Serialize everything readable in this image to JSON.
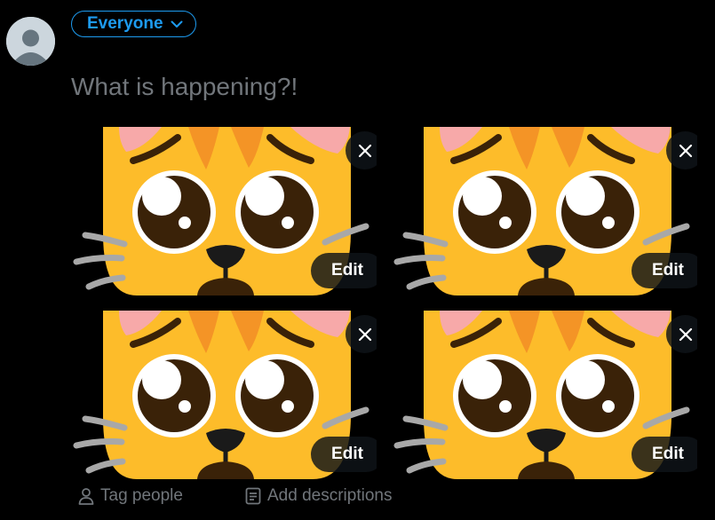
{
  "composer": {
    "audience_label": "Everyone",
    "placeholder": "What is happening?!"
  },
  "media": {
    "items": [
      {
        "edit_label": "Edit"
      },
      {
        "edit_label": "Edit"
      },
      {
        "edit_label": "Edit"
      },
      {
        "edit_label": "Edit"
      }
    ]
  },
  "actions": {
    "tag_people": "Tag people",
    "add_descriptions": "Add descriptions"
  },
  "colors": {
    "background": "#000000",
    "accent": "#1d9bf0",
    "muted_text": "#71767b",
    "cat_fur": "#fdbc2a",
    "cat_stripes": "#f49426",
    "cat_ears": "#f7a9a9"
  },
  "icons": [
    "avatar-default-icon",
    "chevron-down-icon",
    "close-icon",
    "person-icon",
    "document-icon"
  ]
}
